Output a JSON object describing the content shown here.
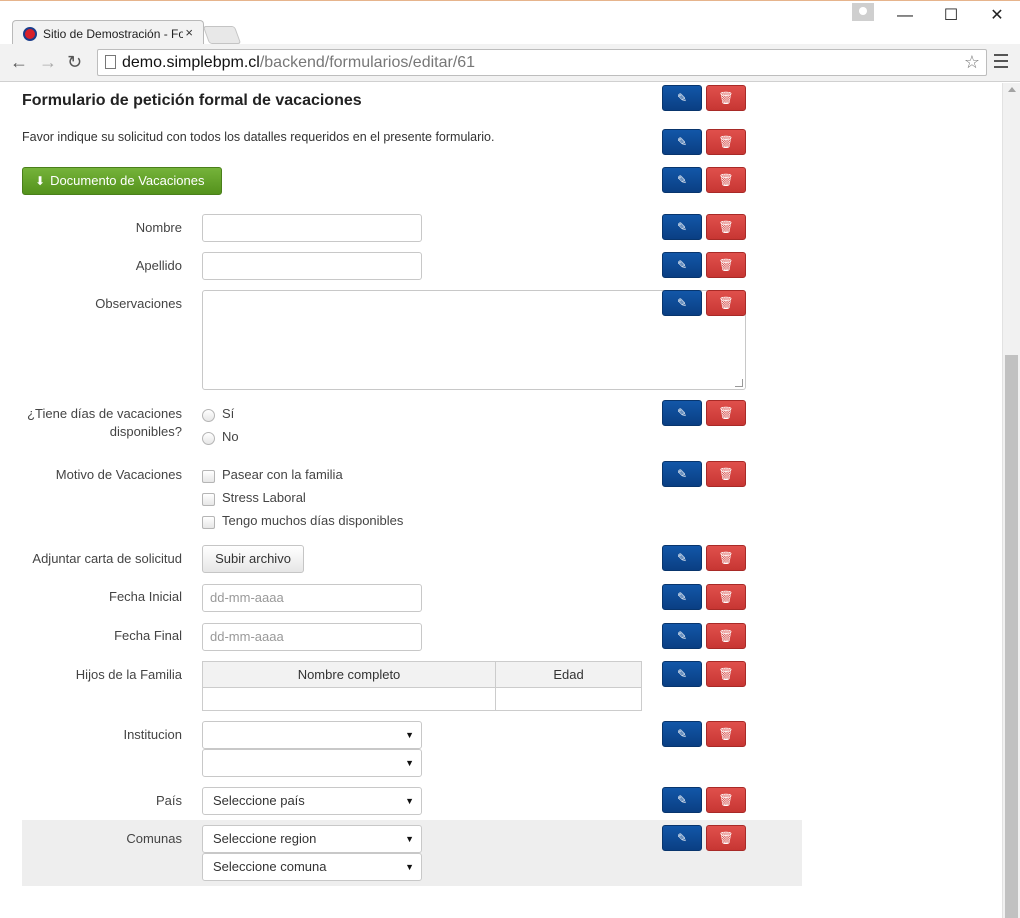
{
  "browser": {
    "tab_title": "Sitio de Demostración - Fo",
    "tab_close": "×",
    "url_host": "demo.simplebpm.cl",
    "url_path": "/backend/formularios/editar/61",
    "minimize": "—",
    "maximize": "☐",
    "close": "✕",
    "back": "←",
    "forward": "→",
    "reload": "↻",
    "star": "☆"
  },
  "form": {
    "title": "Formulario de petición formal de vacaciones",
    "description": "Favor indique su solicitud con todos los datalles requeridos en el presente formulario.",
    "document_button": "Documento de Vacaciones",
    "fields": {
      "nombre": "Nombre",
      "apellido": "Apellido",
      "observaciones": "Observaciones",
      "dias_line1": "¿Tiene días de vacaciones",
      "dias_line2": "disponibles?",
      "motivo": "Motivo de Vacaciones",
      "adjuntar": "Adjuntar carta de solicitud",
      "fecha_inicial": "Fecha Inicial",
      "fecha_final": "Fecha Final",
      "hijos": "Hijos de la Familia",
      "institucion": "Institucion",
      "pais": "País",
      "comunas": "Comunas"
    },
    "radio_options": [
      "Sí",
      "No"
    ],
    "checkbox_options": [
      "Pasear con la familia",
      "Stress Laboral",
      "Tengo muchos días disponibles"
    ],
    "upload_label": "Subir archivo",
    "date_placeholder": "dd-mm-aaaa",
    "table_headers": [
      "Nombre completo",
      "Edad"
    ],
    "pais_select": "Seleccione país",
    "region_select": "Seleccione region",
    "comuna_select": "Seleccione comuna",
    "caret": "▼"
  },
  "actions": {
    "edit_icon": "✎",
    "delete_icon": "🗑"
  }
}
